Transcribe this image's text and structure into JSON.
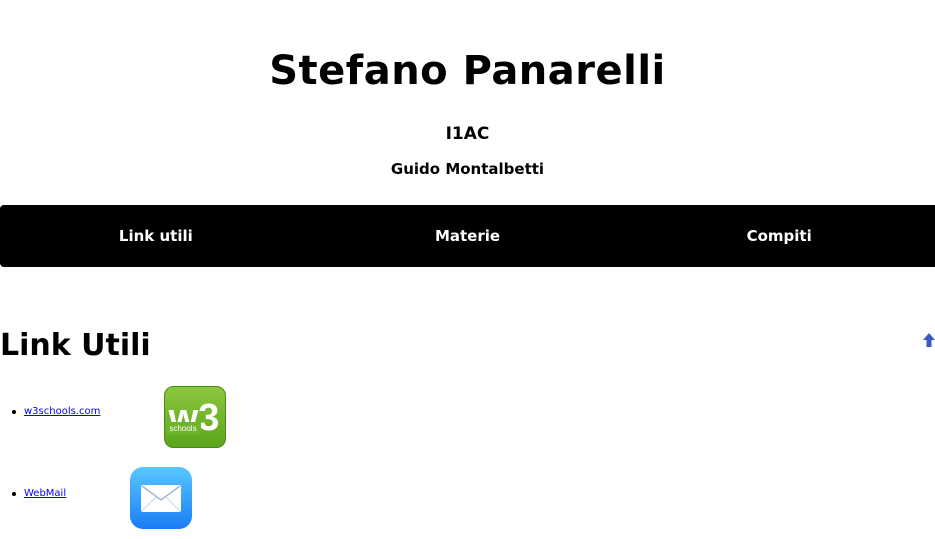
{
  "header": {
    "title": "Stefano Panarelli",
    "classe": "I1AC",
    "teacher": "Guido Montalbetti"
  },
  "nav": {
    "items": [
      "Link utili",
      "Materie",
      "Compiti"
    ]
  },
  "section": {
    "title": "Link Utili"
  },
  "links": [
    {
      "label": "w3schools.com",
      "icon": "w3schools-logo",
      "logo_text_small": "schools",
      "logo_text_big": "w3"
    },
    {
      "label": "WebMail",
      "icon": "mail-envelope-icon"
    }
  ],
  "colors": {
    "nav_bg": "#000000",
    "nav_text": "#ffffff",
    "link": "#0000ee",
    "w3_green_top": "#8dc63f",
    "w3_green_bottom": "#5aa61b",
    "mail_blue_top": "#58c8ff",
    "mail_blue_bottom": "#1a7cf5",
    "arrow": "#3a58c8"
  }
}
